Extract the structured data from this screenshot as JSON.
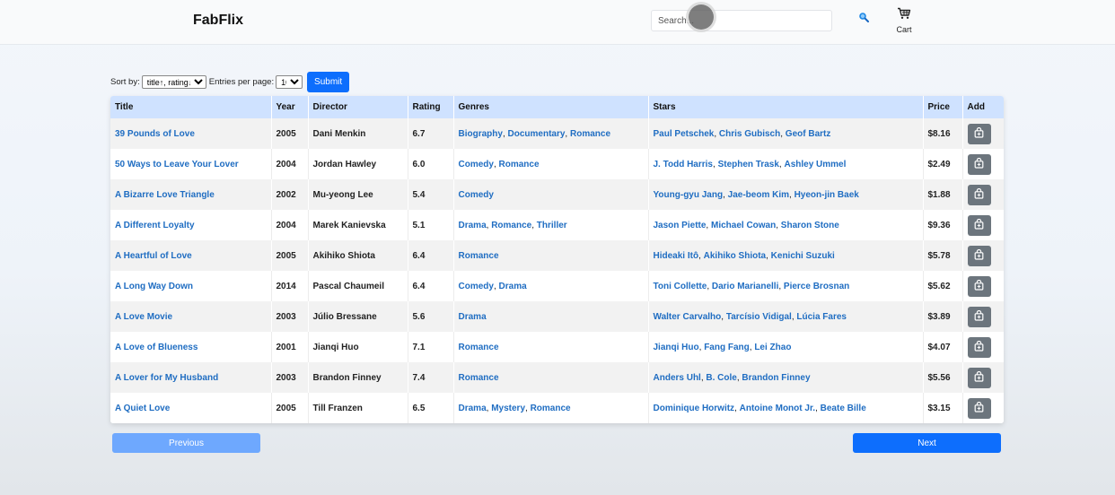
{
  "header": {
    "brand": "FabFlix",
    "search_placeholder": "Search...",
    "cart_label": "Cart"
  },
  "controls": {
    "sort_label": "Sort by:",
    "sort_selected": "title↑, rating↓",
    "entries_label": "Entries per page:",
    "entries_selected": "10",
    "submit_label": "Submit"
  },
  "table": {
    "columns": [
      "Title",
      "Year",
      "Director",
      "Rating",
      "Genres",
      "Stars",
      "Price",
      "Add"
    ],
    "rows": [
      {
        "title": "39 Pounds of Love",
        "year": "2005",
        "director": "Dani Menkin",
        "rating": "6.7",
        "genres": [
          "Biography",
          "Documentary",
          "Romance"
        ],
        "stars": [
          "Paul Petschek",
          "Chris Gubisch",
          "Geof Bartz"
        ],
        "price": "$8.16"
      },
      {
        "title": "50 Ways to Leave Your Lover",
        "year": "2004",
        "director": "Jordan Hawley",
        "rating": "6.0",
        "genres": [
          "Comedy",
          "Romance"
        ],
        "stars": [
          "J. Todd Harris",
          "Stephen Trask",
          "Ashley Ummel"
        ],
        "price": "$2.49"
      },
      {
        "title": "A Bizarre Love Triangle",
        "year": "2002",
        "director": "Mu-yeong Lee",
        "rating": "5.4",
        "genres": [
          "Comedy"
        ],
        "stars": [
          "Young-gyu Jang",
          "Jae-beom Kim",
          "Hyeon-jin Baek"
        ],
        "price": "$1.88"
      },
      {
        "title": "A Different Loyalty",
        "year": "2004",
        "director": "Marek Kanievska",
        "rating": "5.1",
        "genres": [
          "Drama",
          "Romance",
          "Thriller"
        ],
        "stars": [
          "Jason Piette",
          "Michael Cowan",
          "Sharon Stone"
        ],
        "price": "$9.36"
      },
      {
        "title": "A Heartful of Love",
        "year": "2005",
        "director": "Akihiko Shiota",
        "rating": "6.4",
        "genres": [
          "Romance"
        ],
        "stars": [
          "Hideaki Itô",
          "Akihiko Shiota",
          "Kenichi Suzuki"
        ],
        "price": "$5.78"
      },
      {
        "title": "A Long Way Down",
        "year": "2014",
        "director": "Pascal Chaumeil",
        "rating": "6.4",
        "genres": [
          "Comedy",
          "Drama"
        ],
        "stars": [
          "Toni Collette",
          "Dario Marianelli",
          "Pierce Brosnan"
        ],
        "price": "$5.62"
      },
      {
        "title": "A Love Movie",
        "year": "2003",
        "director": "Júlio Bressane",
        "rating": "5.6",
        "genres": [
          "Drama"
        ],
        "stars": [
          "Walter Carvalho",
          "Tarcísio Vidigal",
          "Lúcia Fares"
        ],
        "price": "$3.89"
      },
      {
        "title": "A Love of Blueness",
        "year": "2001",
        "director": "Jianqi Huo",
        "rating": "7.1",
        "genres": [
          "Romance"
        ],
        "stars": [
          "Jianqi Huo",
          "Fang Fang",
          "Lei Zhao"
        ],
        "price": "$4.07"
      },
      {
        "title": "A Lover for My Husband",
        "year": "2003",
        "director": "Brandon Finney",
        "rating": "7.4",
        "genres": [
          "Romance"
        ],
        "stars": [
          "Anders Uhl",
          "B. Cole",
          "Brandon Finney"
        ],
        "price": "$5.56"
      },
      {
        "title": "A Quiet Love",
        "year": "2005",
        "director": "Till Franzen",
        "rating": "6.5",
        "genres": [
          "Drama",
          "Mystery",
          "Romance"
        ],
        "stars": [
          "Dominique Horwitz",
          "Antoine Monot Jr.",
          "Beate Bille"
        ],
        "price": "$3.15"
      }
    ]
  },
  "pagination": {
    "previous_label": "Previous",
    "next_label": "Next"
  },
  "colors": {
    "accent": "#0d6efd",
    "link": "#1f6dc2",
    "header_row": "#cfe2ff",
    "add_button": "#6c757d"
  },
  "icons": {
    "search": "magnifier-icon",
    "cart": "cart-icon",
    "add": "bag-icon"
  }
}
